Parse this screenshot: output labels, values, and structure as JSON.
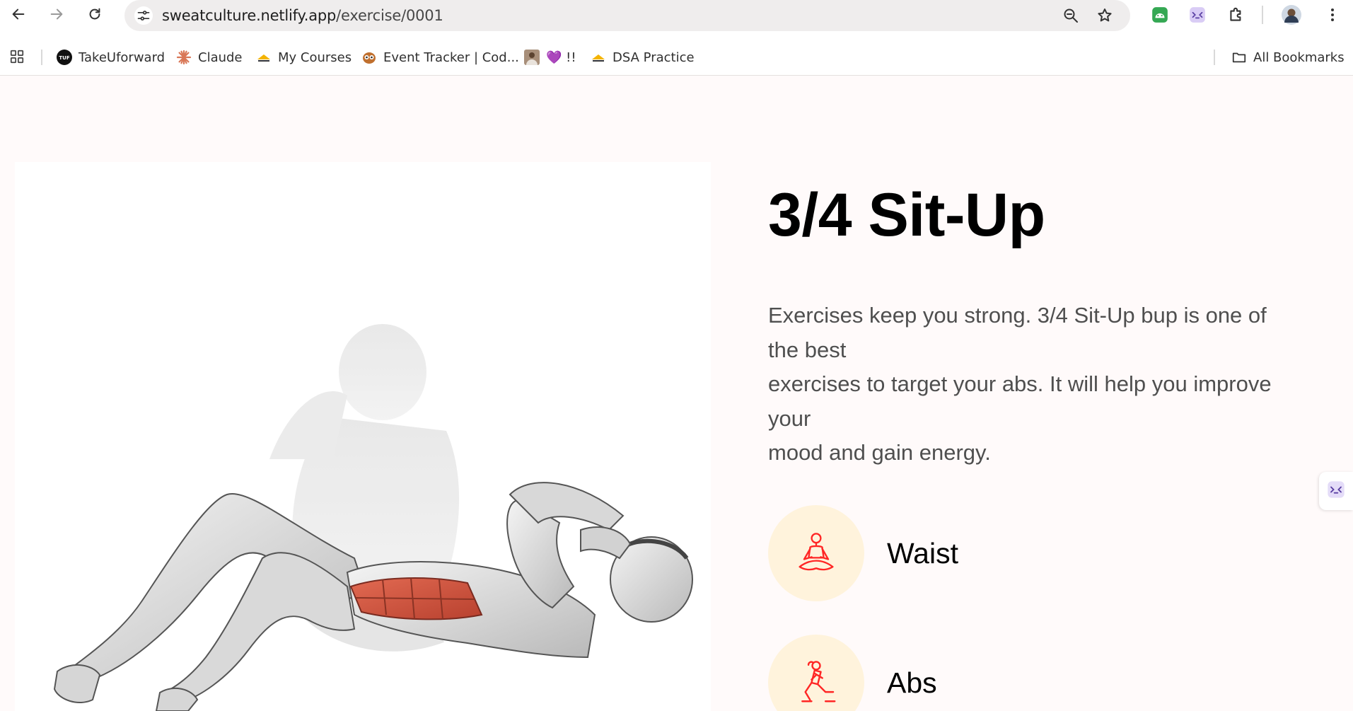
{
  "browser": {
    "url_host": "sweatculture.netlify.app",
    "url_path": "/exercise/0001",
    "nav_icons": [
      "back-arrow-icon",
      "forward-arrow-icon",
      "reload-icon",
      "site-info-icon"
    ],
    "omnibox_icons": [
      "zoom-icon",
      "bookmark-star-icon"
    ],
    "extension_icons": [
      "android-extension-icon",
      "ai-extension-icon",
      "puzzle-extensions-icon",
      "profile-avatar-icon",
      "kebab-menu-icon"
    ]
  },
  "bookmarks": {
    "apps_icon": "apps-grid-icon",
    "items": [
      {
        "label": "TakeUforward",
        "icon": "tuf-logo-icon"
      },
      {
        "label": "Claude",
        "icon": "claude-spark-icon"
      },
      {
        "label": "My Courses",
        "icon": "courses-logo-icon"
      },
      {
        "label": "Event Tracker | Cod...",
        "icon": "owl-icon"
      },
      {
        "label": "💜 !!",
        "icon": "photo-thumb-icon"
      },
      {
        "label": "DSA Practice",
        "icon": "dsa-logo-icon"
      }
    ],
    "all_bookmarks": "All Bookmarks"
  },
  "exercise": {
    "title": "3/4 Sit-Up",
    "description_lines": [
      "Exercises keep you strong. 3/4 Sit-Up bup is one of",
      "the best",
      "exercises to target your abs. It will help you improve",
      "your",
      "mood and gain energy."
    ],
    "body_parts": [
      {
        "label": "Waist",
        "icon": "meditation-icon"
      },
      {
        "label": "Abs",
        "icon": "lunge-workout-icon"
      }
    ]
  },
  "colors": {
    "page_bg": "#fffafa",
    "badge_bg": "#fff3dc",
    "accent_red": "#ff2625",
    "muscle_highlight": "#d9543f"
  }
}
